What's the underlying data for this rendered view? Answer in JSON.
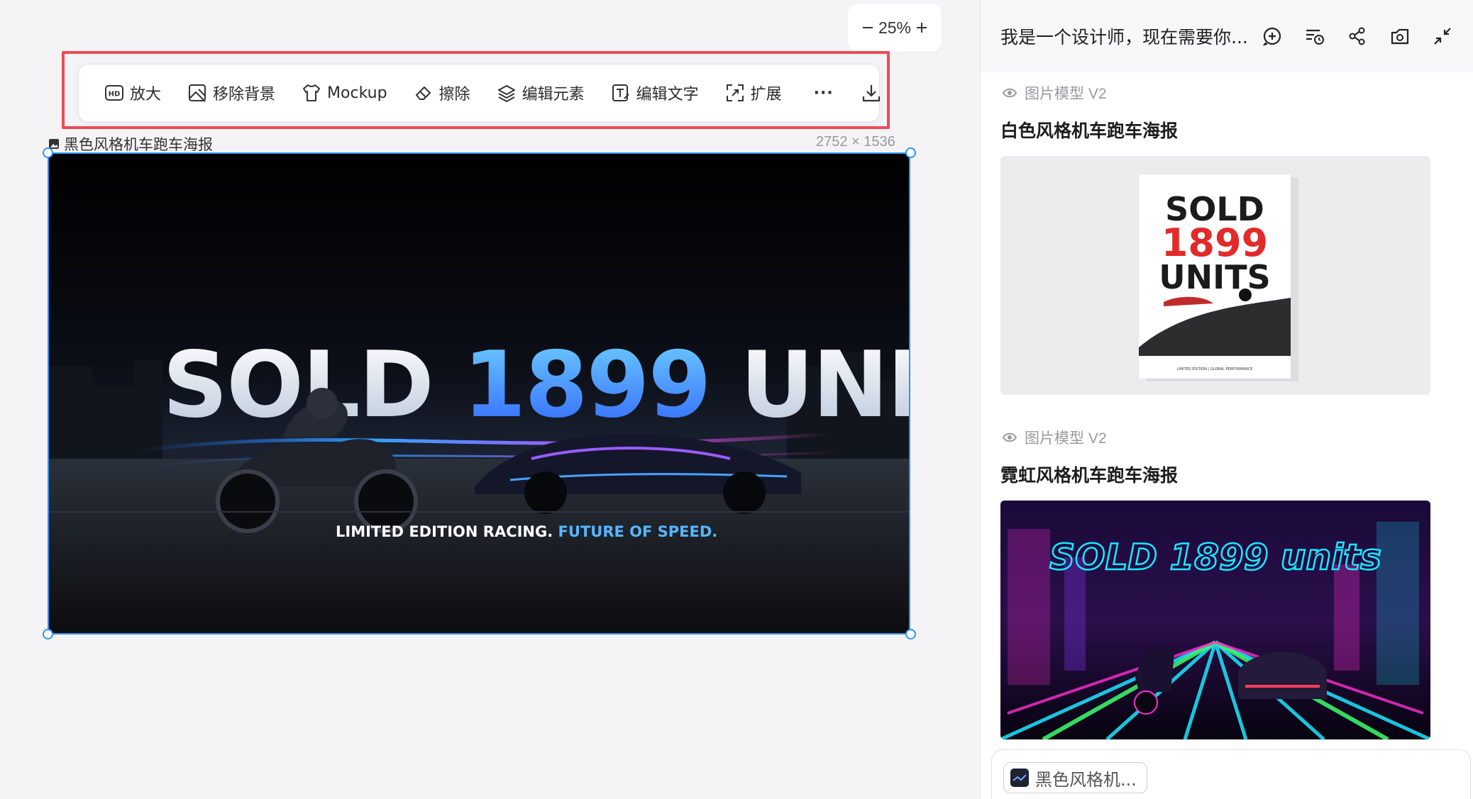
{
  "zoom": {
    "value": "25%",
    "minus": "−",
    "plus": "+"
  },
  "toolbar": {
    "upscale_label": "放大",
    "remove_bg_label": "移除背景",
    "mockup_label": "Mockup",
    "erase_label": "擦除",
    "edit_elements_label": "编辑元素",
    "edit_text_label": "编辑文字",
    "expand_label": "扩展",
    "more_label": "···"
  },
  "canvas": {
    "image_title": "黑色风格机车跑车海报",
    "image_size": "2752 × 1536"
  },
  "poster": {
    "headline_a": "SOLD ",
    "headline_b": "1899",
    "headline_c": " UNITS",
    "tagline_a": "LIMITED EDITION RACING. ",
    "tagline_b": "FUTURE OF SPEED."
  },
  "panel": {
    "title": "我是一个设计师，现在需要你...",
    "cards": [
      {
        "model": "图片模型 V2",
        "title": "白色风格机车跑车海报",
        "poster_lines": [
          "SOLD",
          "1899",
          "UNITS"
        ],
        "footer": "LIMITED EDITION | GLOBAL PERFORMANCE"
      },
      {
        "model": "图片模型 V2",
        "title": "霓虹风格机车跑车海报",
        "neon_text": "SOLD 1899 units"
      }
    ],
    "attachment_chip": "黑色风格机..."
  },
  "colors": {
    "accent_blue": "#2e95f4",
    "highlight_red": "#ee4a55",
    "neon_pink": "#ff2fd0",
    "neon_cyan": "#19e8ff",
    "neon_green": "#3cff6b"
  }
}
